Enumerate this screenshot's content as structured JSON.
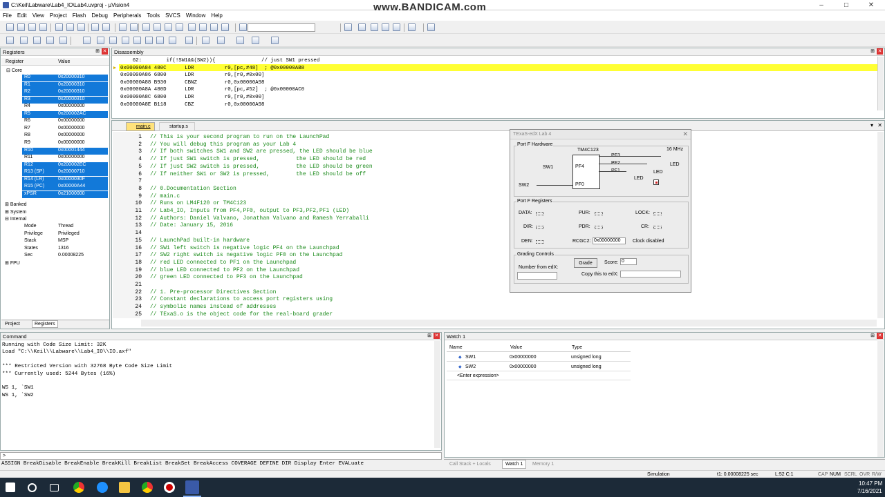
{
  "window": {
    "title": "C:\\Keil\\Labware\\Lab4_IO\\Lab4.uvproj - µVision4",
    "watermark": "www.BANDICAM.com"
  },
  "menu": [
    "File",
    "Edit",
    "View",
    "Project",
    "Flash",
    "Debug",
    "Peripherals",
    "Tools",
    "SVCS",
    "Window",
    "Help"
  ],
  "registers": {
    "title": "Registers",
    "col_reg": "Register",
    "col_val": "Value",
    "core": "Core",
    "rows": [
      {
        "n": "R0",
        "v": "0x20000310",
        "sel": true
      },
      {
        "n": "R1",
        "v": "0x20000310",
        "sel": true
      },
      {
        "n": "R2",
        "v": "0x20000310",
        "sel": true
      },
      {
        "n": "R3",
        "v": "0x20000310",
        "sel": true
      },
      {
        "n": "R4",
        "v": "0x00000000",
        "sel": false
      },
      {
        "n": "R5",
        "v": "0x200002AC",
        "sel": true
      },
      {
        "n": "R6",
        "v": "0x00000000",
        "sel": false
      },
      {
        "n": "R7",
        "v": "0x00000000",
        "sel": false
      },
      {
        "n": "R8",
        "v": "0x00000000",
        "sel": false
      },
      {
        "n": "R9",
        "v": "0x00000000",
        "sel": false
      },
      {
        "n": "R10",
        "v": "0x00001444",
        "sel": true
      },
      {
        "n": "R11",
        "v": "0x00000000",
        "sel": false
      },
      {
        "n": "R12",
        "v": "0x200002EC",
        "sel": true
      },
      {
        "n": "R13 (SP)",
        "v": "0x20000710",
        "sel": true
      },
      {
        "n": "R14 (LR)",
        "v": "0x0000030F",
        "sel": true
      },
      {
        "n": "R15 (PC)",
        "v": "0x00000A44",
        "sel": true
      },
      {
        "n": "xPSR",
        "v": "0x21000000",
        "sel": true
      }
    ],
    "groups": [
      "Banked",
      "System",
      "Internal"
    ],
    "internal": [
      {
        "n": "Mode",
        "v": "Thread"
      },
      {
        "n": "Privilege",
        "v": "Privileged"
      },
      {
        "n": "Stack",
        "v": "MSP"
      },
      {
        "n": "States",
        "v": "1316"
      },
      {
        "n": "Sec",
        "v": "0.00008225"
      }
    ],
    "fpu": "FPU",
    "tab_project": "Project",
    "tab_registers": "Registers"
  },
  "disassembly": {
    "title": "Disassembly",
    "lines": [
      "    62:        if(!SW1&&(SW2)){               // just SW1 pressed",
      "0x00000A84 480C      LDR          r0,[pc,#48]  ; @0x00000AB8",
      "0x00000A86 6800      LDR          r0,[r0,#0x00]",
      "0x00000A88 B930      CBNZ         r0,0x00000A98",
      "0x00000A8A 480D      LDR          r0,[pc,#52]  ; @0x00000AC0",
      "0x00000A8C 6800      LDR          r0,[r0,#0x00]",
      "0x00000A8E B118      CBZ          r0,0x00000A98"
    ]
  },
  "editor": {
    "tabs": [
      "main.c",
      "startup.s"
    ],
    "lines": [
      [
        "1",
        "// This is your second program to run on the LaunchPad"
      ],
      [
        "2",
        "// You will debug this program as your Lab 4"
      ],
      [
        "3",
        "// If both switches SW1 and SW2 are pressed, the LED should be blue"
      ],
      [
        "4",
        "// If just SW1 switch is pressed,           the LED should be red"
      ],
      [
        "5",
        "// If just SW2 switch is pressed,           the LED should be green"
      ],
      [
        "6",
        "// If neither SW1 or SW2 is pressed,        the LED should be off"
      ],
      [
        "7",
        ""
      ],
      [
        "8",
        "// 0.Documentation Section"
      ],
      [
        "9",
        "// main.c"
      ],
      [
        "10",
        "// Runs on LM4F120 or TM4C123"
      ],
      [
        "11",
        "// Lab4_IO, Inputs from PF4,PF0, output to PF3,PF2,PF1 (LED)"
      ],
      [
        "12",
        "// Authors: Daniel Valvano, Jonathan Valvano and Ramesh Yerraballi"
      ],
      [
        "13",
        "// Date: January 15, 2016"
      ],
      [
        "14",
        ""
      ],
      [
        "15",
        "// LaunchPad built-in hardware"
      ],
      [
        "16",
        "// SW1 left switch is negative logic PF4 on the Launchpad"
      ],
      [
        "17",
        "// SW2 right switch is negative logic PF0 on the Launchpad"
      ],
      [
        "18",
        "// red LED connected to PF1 on the Launchpad"
      ],
      [
        "19",
        "// blue LED connected to PF2 on the Launchpad"
      ],
      [
        "20",
        "// green LED connected to PF3 on the Launchpad"
      ],
      [
        "21",
        ""
      ],
      [
        "22",
        "// 1. Pre-processor Directives Section"
      ],
      [
        "23",
        "// Constant declarations to access port registers using"
      ],
      [
        "24",
        "// symbolic names instead of addresses"
      ],
      [
        "25",
        "// TExaS.o is the object code for the real-board grader"
      ]
    ]
  },
  "dialog": {
    "title": "TExaS-edX Lab 4",
    "hw_title": "Port F Hardware",
    "chip": "TM4C123",
    "freq": "16 MHz",
    "sw1": "SW1",
    "sw2": "SW2",
    "pf4": "PF4",
    "pf0": "PF0",
    "pf3": "PF3",
    "pf2": "PF2",
    "pf1": "PF1",
    "led": "LED",
    "regs_title": "Port F Registers",
    "data": "DATA:",
    "pur": "PUR:",
    "lock": "LOCK:",
    "dir": "DIR:",
    "pdr": "PDR:",
    "cr": "CR:",
    "den": "DEN:",
    "rcgc2": "RCGC2:",
    "rcgc2_val": "0x00000000",
    "clock": "Clock disabled",
    "grading": "Grading Controls",
    "number": "Number from edX:",
    "grade": "Grade",
    "score": "Score:",
    "score_val": "0",
    "copy": "Copy this to edX:"
  },
  "command": {
    "title": "Command",
    "lines": [
      "Running with Code Size Limit: 32K",
      "Load \"C:\\\\Keil\\\\Labware\\\\Lab4_IO\\\\IO.axf\"",
      "",
      "*** Restricted Version with 32768 Byte Code Size Limit",
      "*** Currently used: 5244 Bytes (16%)",
      "",
      "WS 1, `SW1",
      "WS 1, `SW2"
    ],
    "prompt": ">",
    "hint": "ASSIGN BreakDisable BreakEnable BreakKill BreakList BreakSet BreakAccess COVERAGE DEFINE DIR Display Enter EVALuate"
  },
  "watch": {
    "title": "Watch 1",
    "col_name": "Name",
    "col_value": "Value",
    "col_type": "Type",
    "rows": [
      {
        "n": "SW1",
        "v": "0x00000000",
        "t": "unsigned long"
      },
      {
        "n": "SW2",
        "v": "0x00000000",
        "t": "unsigned long"
      }
    ],
    "enter": "<Enter expression>",
    "tabs": [
      "Call Stack + Locals",
      "Watch 1",
      "Memory 1"
    ]
  },
  "status": {
    "mode": "Simulation",
    "time": "t1: 0.00008225 sec",
    "pos": "L:52 C:1",
    "caps": "CAP",
    "num": "NUM",
    "scrl": "SCRL",
    "ovr": "OVR",
    "rw": "R/W"
  },
  "taskbar": {
    "time": "10:47 PM",
    "date": "7/16/2021"
  },
  "colors": {
    "selection": "#1279d9",
    "highlight": "#ffff33",
    "comment": "#1a8a1a"
  }
}
